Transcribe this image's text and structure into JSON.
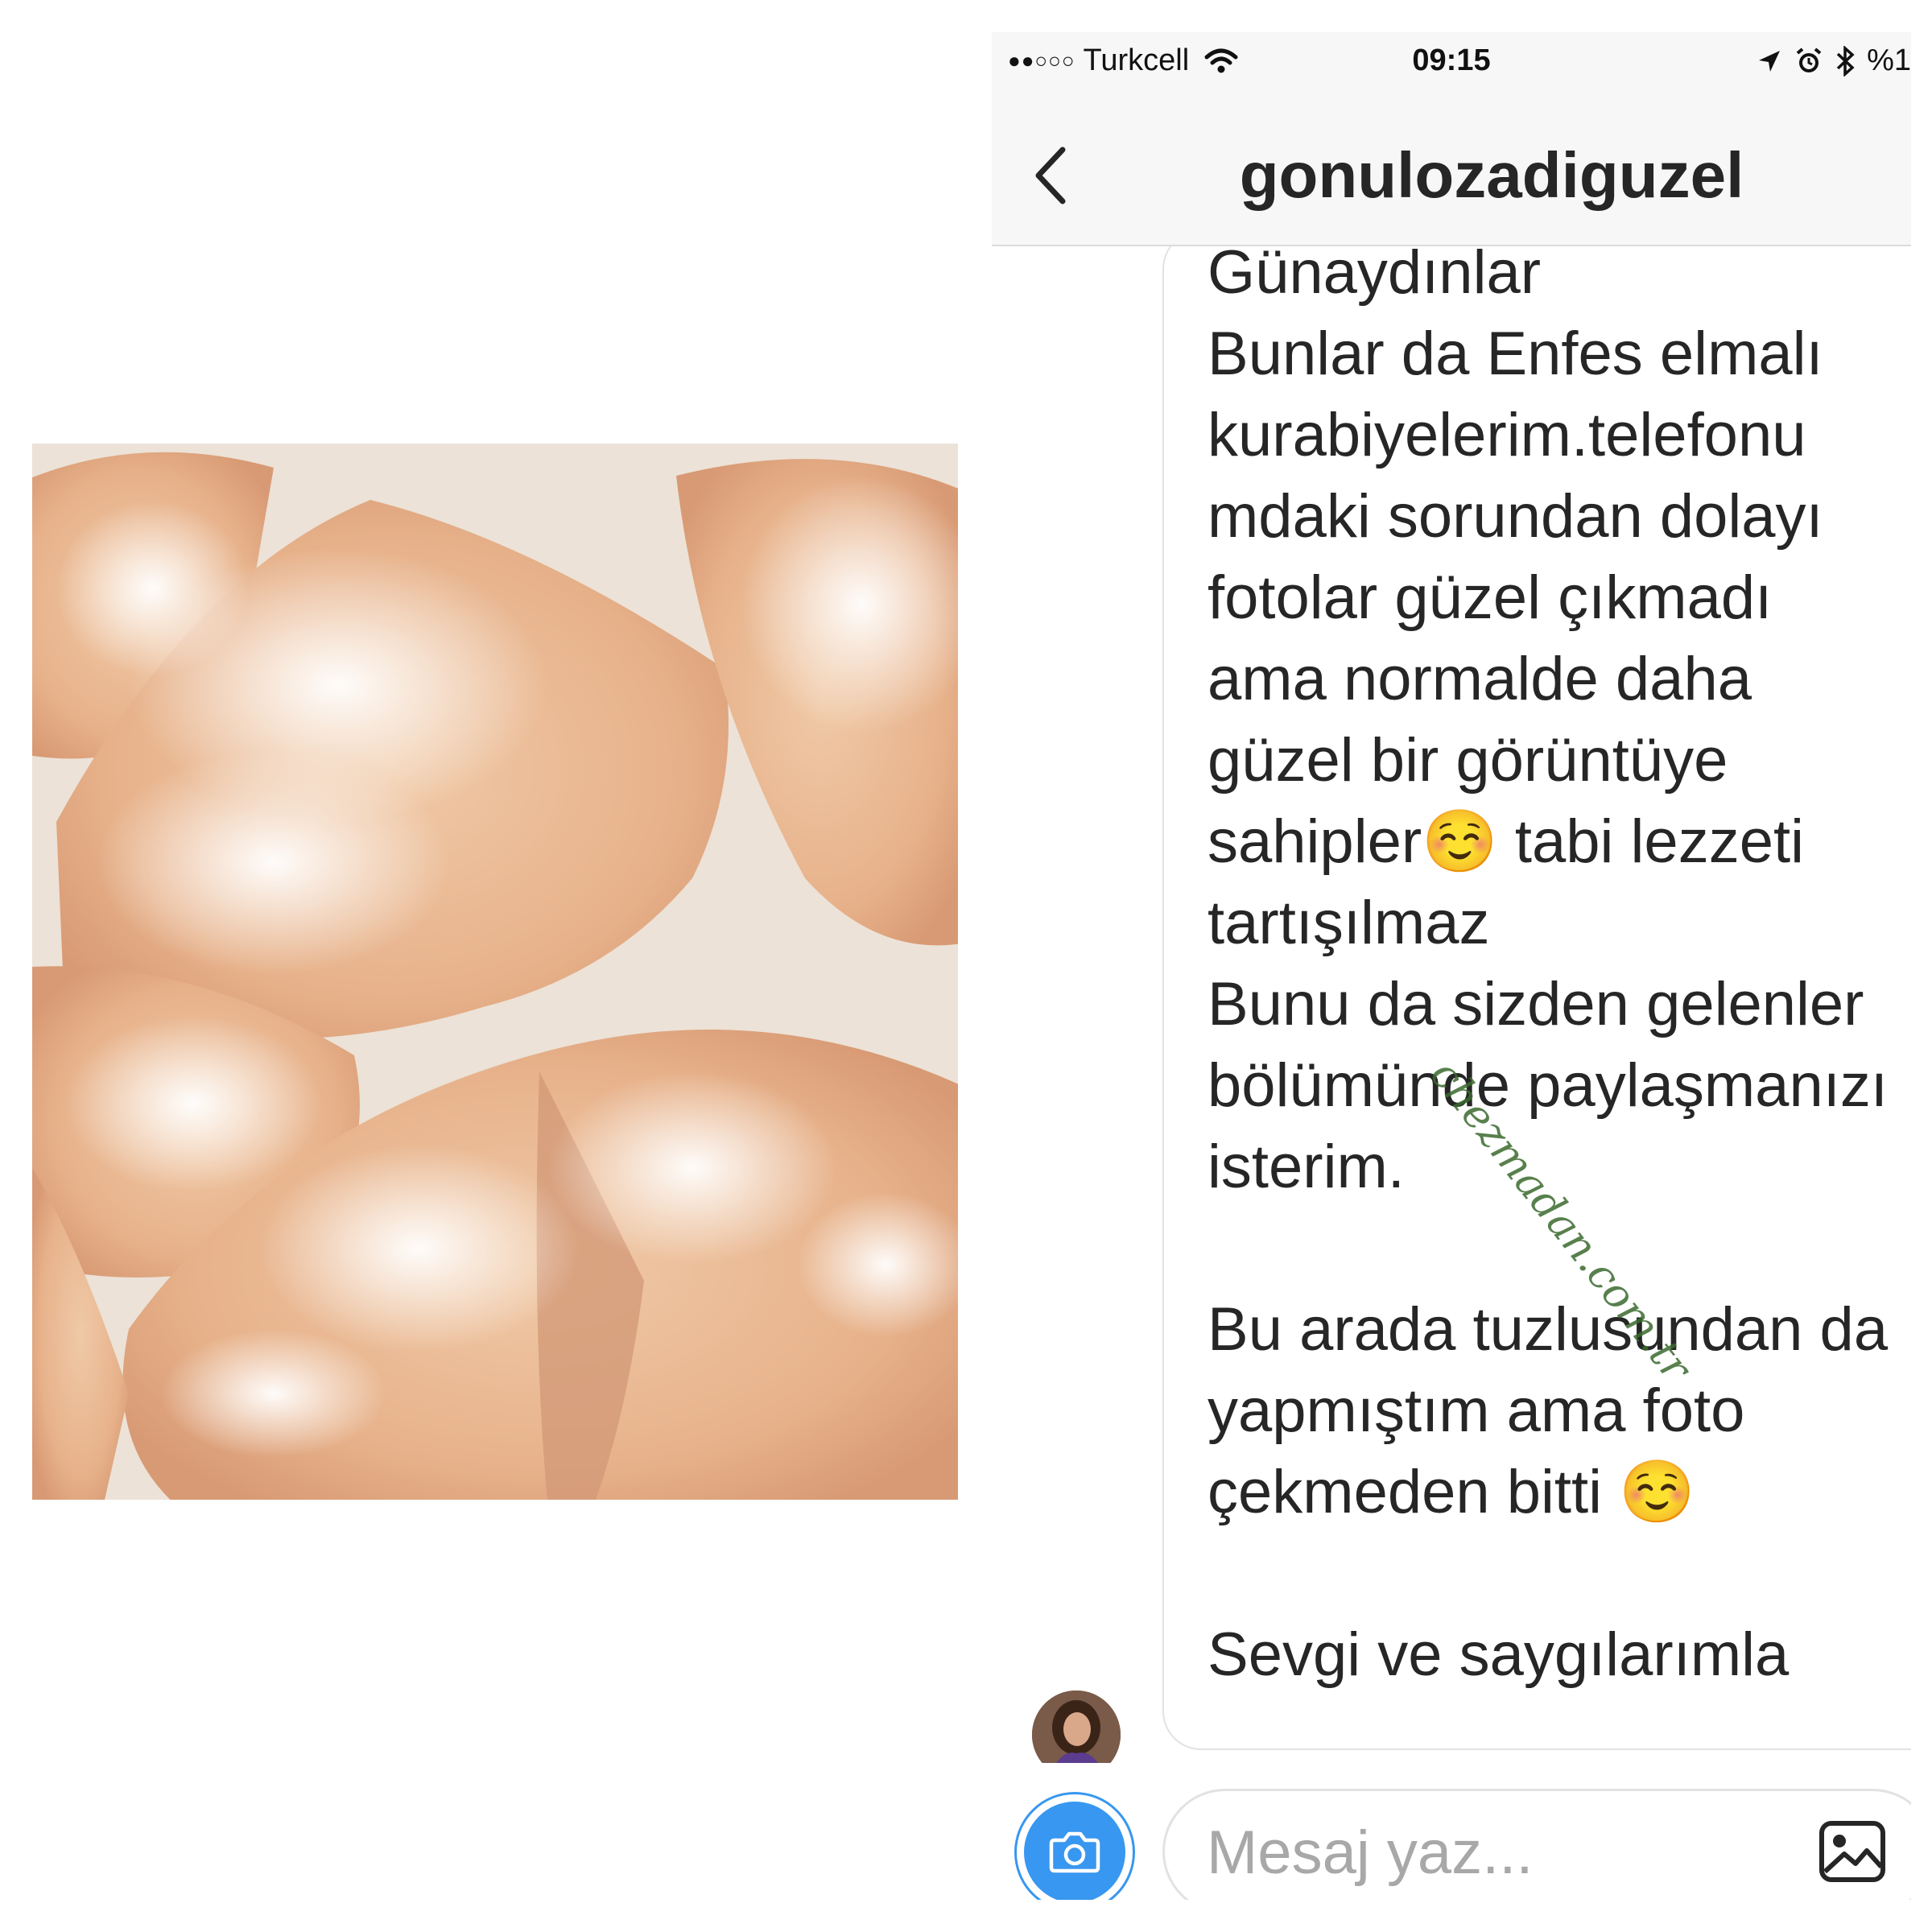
{
  "status_bar": {
    "signal": "●●○○○",
    "carrier": "Turkcell",
    "time": "09:15",
    "battery": "%1"
  },
  "header": {
    "back_icon": "chevron-left-icon",
    "title": "gonulozadiguzel"
  },
  "message": {
    "text": "Günaydınlar\nBunlar da Enfes elmalı kurabiyelerim.telefonu mdaki sorundan dolayı fotolar güzel çıkmadı ama normalde daha güzel bir görüntüye sahipler☺️ tabi lezzeti tartışılmaz\nBunu da sizden gelenler bölümünde paylaşmanızı isterim.\n\nBu arada tuzlusundan da yapmıştım ama foto çekmeden bitti ☺️\n\nSevgi ve saygılarımla"
  },
  "watermark": "chezmadan.com.tr",
  "composer": {
    "placeholder": "Mesaj yaz...",
    "camera_icon": "camera-icon",
    "gallery_icon": "image-icon"
  },
  "colors": {
    "accent": "#3897f0",
    "text": "#262626",
    "placeholder": "#a8a8a8",
    "watermark": "#3b6b2e"
  }
}
